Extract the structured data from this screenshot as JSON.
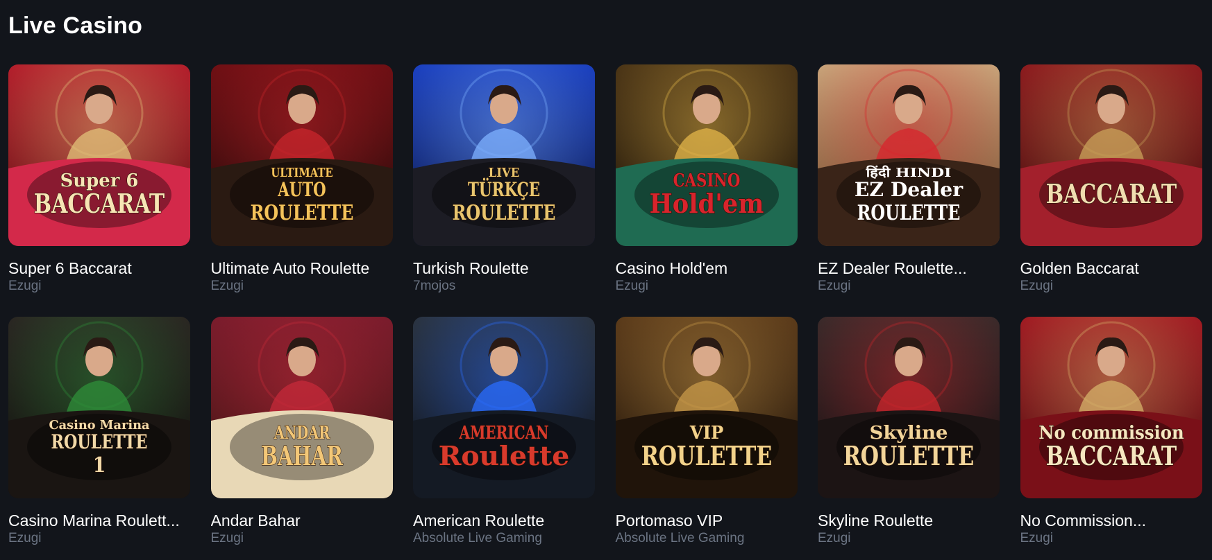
{
  "section": {
    "title": "Live Casino"
  },
  "games": [
    {
      "name": "Super 6 Baccarat",
      "provider": "Ezugi",
      "art": {
        "line1": "Super 6",
        "line2": "BACCARAT",
        "line3": ""
      },
      "palette": {
        "bg1": "#b31d2b",
        "bg2": "#5e0c12",
        "floor": "#d3294a",
        "accent": "#e2c27a",
        "text": "#f7e5b5"
      }
    },
    {
      "name": "Ultimate Auto Roulette",
      "provider": "Ezugi",
      "art": {
        "line1": "ULTIMATE",
        "line2": "AUTO",
        "line3": "ROULETTE"
      },
      "palette": {
        "bg1": "#6e0f14",
        "bg2": "#1c0a08",
        "floor": "#2a1a12",
        "accent": "#c9262c",
        "text": "#f4c35a"
      }
    },
    {
      "name": "Turkish Roulette",
      "provider": "7mojos",
      "art": {
        "line1": "LIVE",
        "line2": "TÜRKÇE",
        "line3": "ROULETTE"
      },
      "palette": {
        "bg1": "#1a3fbf",
        "bg2": "#0a1440",
        "floor": "#1c1c24",
        "accent": "#7fb2ff",
        "text": "#e8c56e"
      }
    },
    {
      "name": "Casino Hold'em",
      "provider": "Ezugi",
      "art": {
        "line1": "CASINO",
        "line2": "Hold'em",
        "line3": ""
      },
      "palette": {
        "bg1": "#4a3416",
        "bg2": "#1a1208",
        "floor": "#1f6b52",
        "accent": "#e3b64a",
        "text": "#d8242c"
      }
    },
    {
      "name": "EZ Dealer Roulette...",
      "provider": "Ezugi",
      "art": {
        "line1": "हिंदी HINDI",
        "line2": "EZ Dealer",
        "line3": "ROULETTE"
      },
      "palette": {
        "bg1": "#c8a47a",
        "bg2": "#6e4a2a",
        "floor": "#3a2418",
        "accent": "#d8242c",
        "text": "#ffffff"
      }
    },
    {
      "name": "Golden Baccarat",
      "provider": "Ezugi",
      "art": {
        "line1": "",
        "line2": "BACCARAT",
        "line3": ""
      },
      "palette": {
        "bg1": "#8c1a1e",
        "bg2": "#3e0a0c",
        "floor": "#a3202c",
        "accent": "#c9a25a",
        "text": "#f1ddb0"
      }
    },
    {
      "name": "Casino Marina Roulett...",
      "provider": "Ezugi",
      "art": {
        "line1": "Casino Marina",
        "line2": "ROULETTE",
        "line3": "1"
      },
      "palette": {
        "bg1": "#2a2622",
        "bg2": "#0f0d0b",
        "floor": "#1a1512",
        "accent": "#2f8f3a",
        "text": "#f1d9a8"
      }
    },
    {
      "name": "Andar Bahar",
      "provider": "Ezugi",
      "art": {
        "line1": "ANDAR",
        "line2": "BAHAR",
        "line3": ""
      },
      "palette": {
        "bg1": "#7a1c2c",
        "bg2": "#3a1410",
        "floor": "#e8d8b6",
        "accent": "#c62a3a",
        "text": "#f3c777"
      }
    },
    {
      "name": "American Roulette",
      "provider": "Absolute Live Gaming",
      "art": {
        "line1": "AMERICAN",
        "line2": "Roulette",
        "line3": ""
      },
      "palette": {
        "bg1": "#2a3340",
        "bg2": "#0d1118",
        "floor": "#141a24",
        "accent": "#2a6cff",
        "text": "#d83a2c"
      }
    },
    {
      "name": "Portomaso VIP",
      "provider": "Absolute Live Gaming",
      "art": {
        "line1": "VIP",
        "line2": "ROULETTE",
        "line3": ""
      },
      "palette": {
        "bg1": "#5a3a1a",
        "bg2": "#1a1008",
        "floor": "#20140a",
        "accent": "#c89a4a",
        "text": "#f2d28a"
      }
    },
    {
      "name": "Skyline Roulette",
      "provider": "Ezugi",
      "art": {
        "line1": "Skyline",
        "line2": "ROULETTE",
        "line3": ""
      },
      "palette": {
        "bg1": "#3a2a2a",
        "bg2": "#140e10",
        "floor": "#1c1414",
        "accent": "#c9262c",
        "text": "#f2d59a"
      }
    },
    {
      "name": "No Commission...",
      "provider": "Ezugi",
      "art": {
        "line1": "No commission",
        "line2": "BACCARAT",
        "line3": ""
      },
      "palette": {
        "bg1": "#a01a22",
        "bg2": "#4a0a0e",
        "floor": "#7a1018",
        "accent": "#d6b26a",
        "text": "#f7e6c0"
      }
    }
  ]
}
